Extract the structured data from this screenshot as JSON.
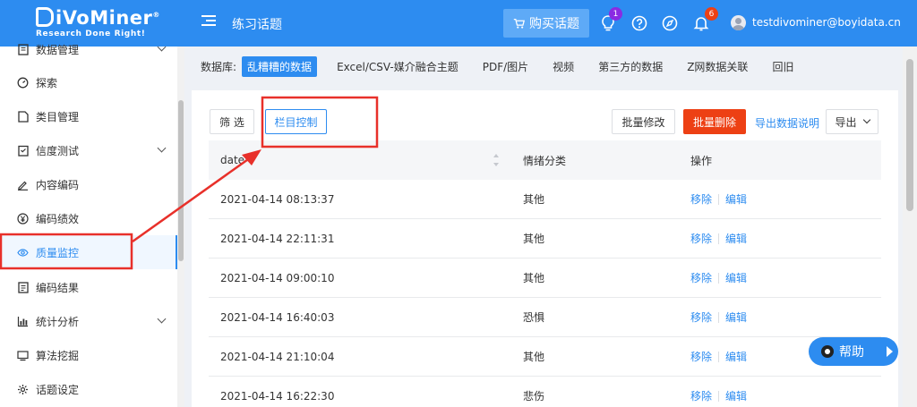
{
  "header": {
    "logo_text": "iVoMiner",
    "logo_reg": "®",
    "logo_tagline": "Research Done Right!",
    "title": "练习话题",
    "buy_label": "购买话题",
    "bulb_badge": "1",
    "bell_badge": "6",
    "user_email": "testdivominer@boyidata.cn",
    "badge_colors": {
      "bulb": "#8a2be2",
      "bell": "#ed4014"
    }
  },
  "sidebar": {
    "items": [
      {
        "label": "数据管理",
        "icon": "document-icon",
        "chevron": true
      },
      {
        "label": "探索",
        "icon": "gauge-icon",
        "chevron": false
      },
      {
        "label": "类目管理",
        "icon": "document-icon",
        "chevron": false
      },
      {
        "label": "信度测试",
        "icon": "clipboard-icon",
        "chevron": true
      },
      {
        "label": "内容编码",
        "icon": "pen-icon",
        "chevron": false
      },
      {
        "label": "编码绩效",
        "icon": "yen-icon",
        "chevron": false
      },
      {
        "label": "质量监控",
        "icon": "eye-icon",
        "chevron": false,
        "active": true
      },
      {
        "label": "编码结果",
        "icon": "list-icon",
        "chevron": false
      },
      {
        "label": "统计分析",
        "icon": "chart-icon",
        "chevron": true
      },
      {
        "label": "算法挖掘",
        "icon": "monitor-icon",
        "chevron": false
      },
      {
        "label": "话题设定",
        "icon": "gear-icon",
        "chevron": false
      }
    ]
  },
  "database_bar": {
    "label": "数据库:",
    "items": [
      "乱糟糟的数据",
      "Excel/CSV-媒介融合主题",
      "PDF/图片",
      "视频",
      "第三方的数据",
      "Z网数据关联",
      "回旧"
    ]
  },
  "toolbar": {
    "filter_label": "筛 选",
    "column_control_label": "栏目控制",
    "batch_edit_label": "批量修改",
    "batch_delete_label": "批量删除",
    "export_desc_label": "导出数据说明",
    "export_label": "导出"
  },
  "table": {
    "headers": [
      "date",
      "情绪分类",
      "操作"
    ],
    "rows": [
      {
        "date": "2021-04-14 08:13:37",
        "emotion": "其他"
      },
      {
        "date": "2021-04-14 22:11:31",
        "emotion": "其他"
      },
      {
        "date": "2021-04-14 09:00:10",
        "emotion": "其他"
      },
      {
        "date": "2021-04-14 16:40:03",
        "emotion": "恐惧"
      },
      {
        "date": "2021-04-14 21:10:04",
        "emotion": "其他"
      },
      {
        "date": "2021-04-14 16:22:30",
        "emotion": "悲伤"
      }
    ],
    "action_remove": "移除",
    "action_edit": "编辑"
  },
  "help": {
    "label": "帮助"
  },
  "colors": {
    "accent": "#2d8cf0",
    "danger": "#ed4014",
    "annotation": "#e8302a"
  }
}
